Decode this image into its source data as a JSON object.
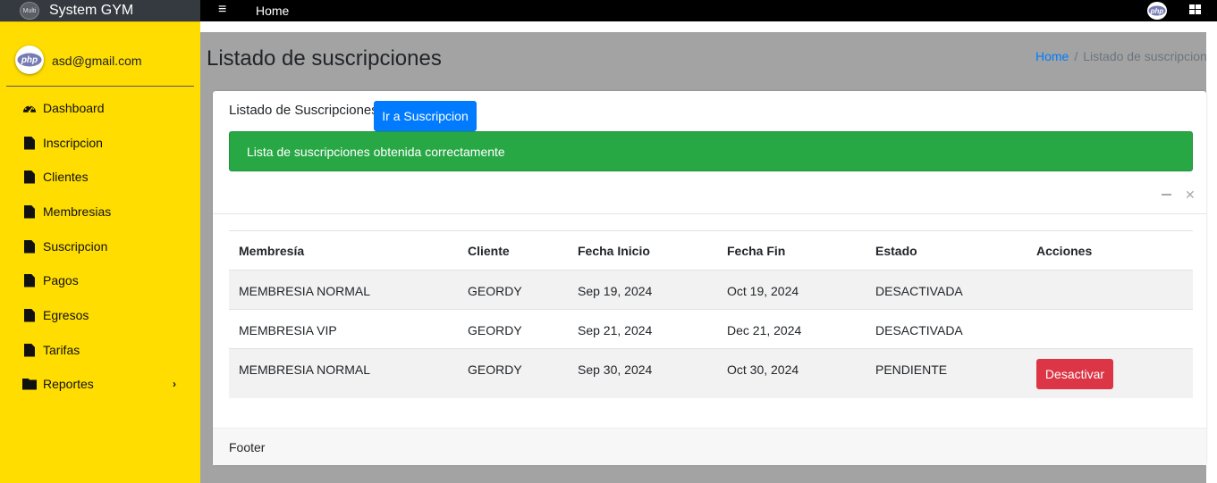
{
  "brand": {
    "logo_text": "Multi",
    "title": "System GYM"
  },
  "navbar": {
    "home_label": "Home",
    "avatar_text": "php"
  },
  "sidebar": {
    "user_email": "asd@gmail.com",
    "avatar_text": "php",
    "items": [
      {
        "label": "Dashboard",
        "icon": "tachometer-icon"
      },
      {
        "label": "Inscripcion",
        "icon": "file-icon"
      },
      {
        "label": "Clientes",
        "icon": "file-icon"
      },
      {
        "label": "Membresias",
        "icon": "file-icon"
      },
      {
        "label": "Suscripcion",
        "icon": "file-icon"
      },
      {
        "label": "Pagos",
        "icon": "file-icon"
      },
      {
        "label": "Egresos",
        "icon": "file-icon"
      },
      {
        "label": "Tarifas",
        "icon": "file-icon"
      },
      {
        "label": "Reportes",
        "icon": "folder-icon"
      }
    ]
  },
  "page": {
    "title": "Listado de suscripciones",
    "breadcrumb": {
      "home": "Home",
      "separator": "/",
      "current": "Listado de suscripciones"
    }
  },
  "card": {
    "heading": "Listado de Suscripciones",
    "go_button": "Ir a Suscripcion",
    "alert": "Lista de suscripciones obtenida correctamente",
    "footer": "Footer"
  },
  "table": {
    "headers": [
      "Membresía",
      "Cliente",
      "Fecha Inicio",
      "Fecha Fin",
      "Estado",
      "Acciones"
    ],
    "rows": [
      [
        "MEMBRESIA NORMAL",
        "GEORDY",
        "Sep 19, 2024",
        "Oct 19, 2024",
        "DESACTIVADA",
        ""
      ],
      [
        "MEMBRESIA VIP",
        "GEORDY",
        "Sep 21, 2024",
        "Dec 21, 2024",
        "DESACTIVADA",
        ""
      ],
      [
        "MEMBRESIA NORMAL",
        "GEORDY",
        "Sep 30, 2024",
        "Oct 30, 2024",
        "PENDIENTE",
        "Desactivar"
      ]
    ]
  },
  "colors": {
    "sidebar": "#ffdd00",
    "primary": "#007bff",
    "success": "#28a745",
    "danger": "#dc3545"
  }
}
